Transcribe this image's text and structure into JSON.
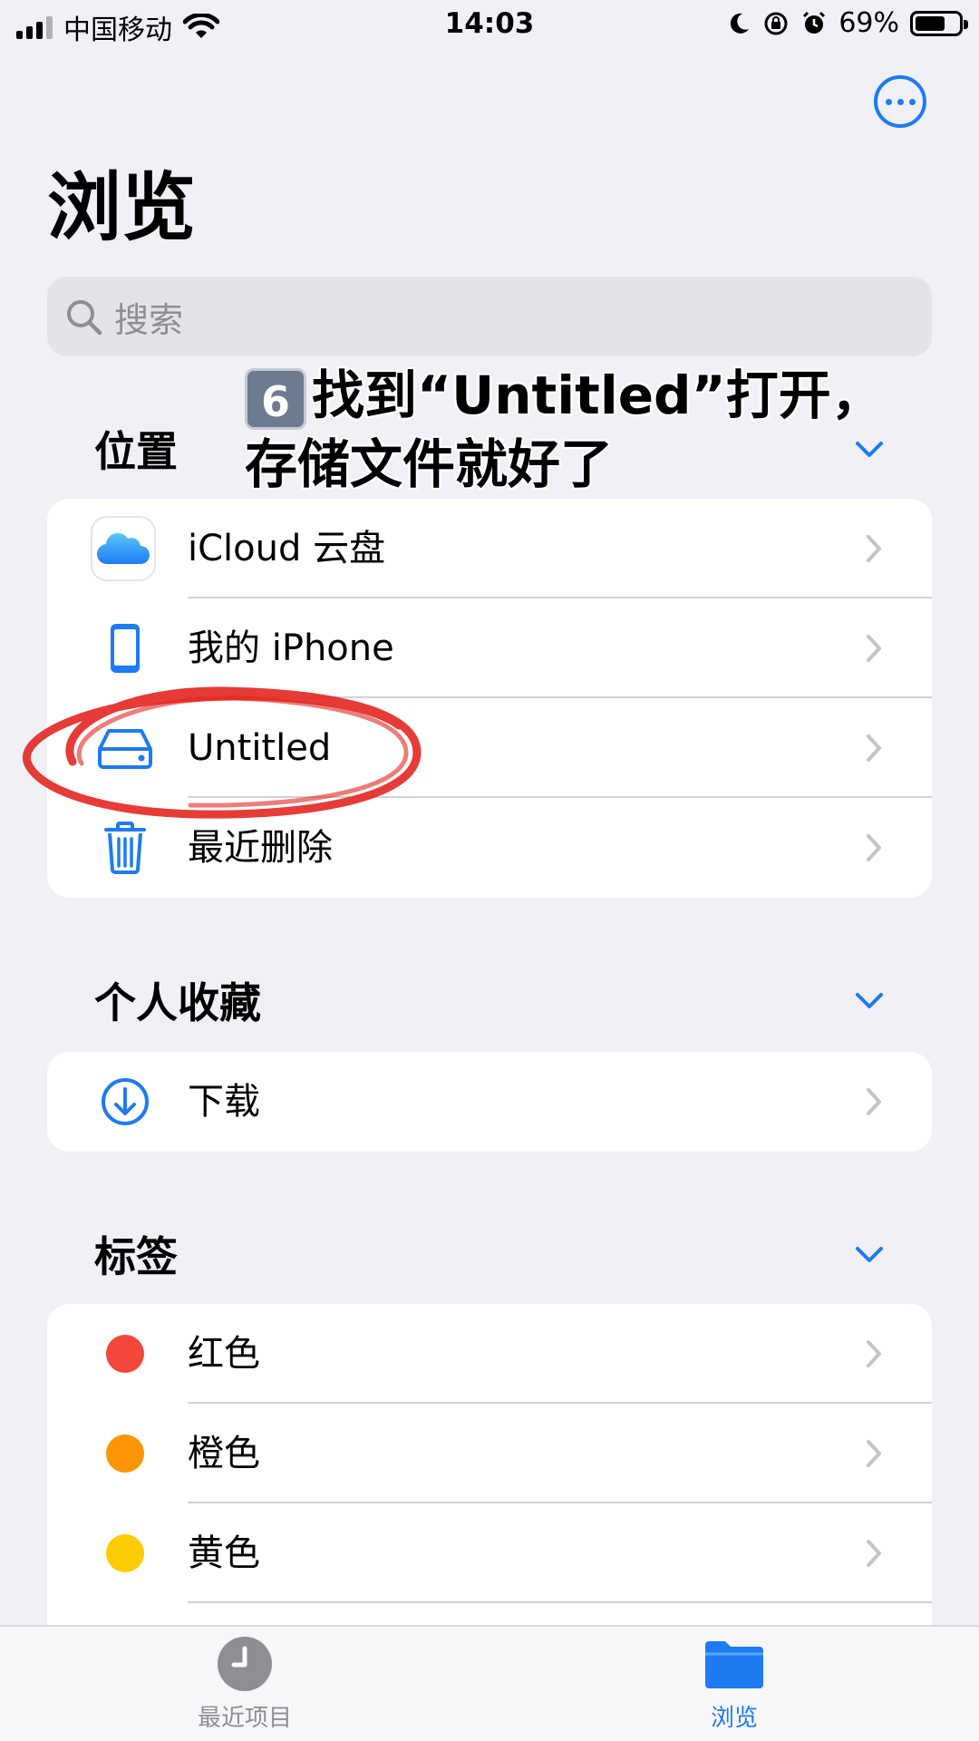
{
  "status_bar": {
    "carrier": "中国移动",
    "time": "14:03",
    "battery": "69%",
    "battery_level": 0.69
  },
  "header": {
    "title": "浏览",
    "more_icon": "ellipsis-circle-icon"
  },
  "search": {
    "placeholder": "搜索"
  },
  "overlay": {
    "step": "6",
    "line1": "找到“Untitled”打开，",
    "line2": "存储文件就好了"
  },
  "locations": {
    "header": "位置",
    "items": [
      {
        "label": "iCloud 云盘",
        "icon": "icloud-icon"
      },
      {
        "label": "我的 iPhone",
        "icon": "iphone-icon"
      },
      {
        "label": "Untitled",
        "icon": "external-drive-icon"
      },
      {
        "label": "最近删除",
        "icon": "trash-icon"
      }
    ]
  },
  "favorites": {
    "header": "个人收藏",
    "items": [
      {
        "label": "下载",
        "icon": "download-icon"
      }
    ]
  },
  "tags": {
    "header": "标签",
    "items": [
      {
        "label": "红色",
        "color": "#f2473a"
      },
      {
        "label": "橙色",
        "color": "#fb9503"
      },
      {
        "label": "黄色",
        "color": "#fecc02"
      }
    ]
  },
  "tab_bar": {
    "recents": "最近项目",
    "browse": "浏览",
    "active_color": "#1e7bf2"
  }
}
